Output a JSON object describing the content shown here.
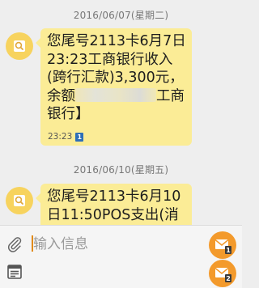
{
  "thread": {
    "messages": [
      {
        "date": "2016/06/07(星期二)",
        "text_before": "您尾号2113卡6月7日23:23工商银行收入(跨行汇款)3,300元，余额",
        "text_after": "工商银行】",
        "time": "23:23",
        "sim": "1",
        "avatar_icon": "search-icon"
      },
      {
        "date": "2016/06/10(星期五)",
        "text_before": "您尾号2113卡6月10日11:50POS支出(消",
        "text_after": "",
        "avatar_icon": "search-icon"
      }
    ]
  },
  "compose": {
    "placeholder": "输入信息",
    "value": "",
    "attach_icon": "paperclip-icon",
    "template_icon": "template-icon",
    "send_buttons": [
      {
        "icon": "envelope-icon",
        "sim": "1"
      },
      {
        "icon": "envelope-icon",
        "sim": "2"
      }
    ]
  },
  "colors": {
    "bubble": "#fbec96",
    "avatar": "#f7d35e",
    "send": "#f39a2c",
    "sim_badge": "#2f6fb7",
    "background": "#eeeeee"
  }
}
